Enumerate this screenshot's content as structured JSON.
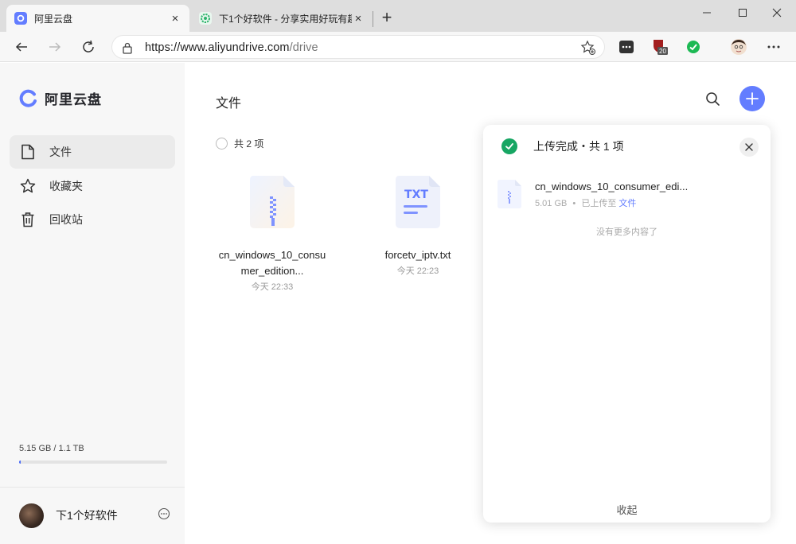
{
  "browser": {
    "tabs": [
      {
        "title": "阿里云盘",
        "close": "×"
      },
      {
        "title": "下1个好软件 - 分享实用好玩有趣",
        "close": "×"
      }
    ],
    "new_tab": "+",
    "url_host": "https://www.aliyundrive.com",
    "url_path": "/drive",
    "extension_badge": "20"
  },
  "sidebar": {
    "logo_text": "阿里云盘",
    "nav": [
      {
        "label": "文件"
      },
      {
        "label": "收藏夹"
      },
      {
        "label": "回收站"
      }
    ],
    "storage": {
      "text": "5.15 GB / 1.1 TB",
      "used_fraction": 0.005
    },
    "user_name": "下1个好软件"
  },
  "main": {
    "title": "文件",
    "select_all_label": "共 2 项",
    "files": [
      {
        "name": "cn_windows_10_consumer_edition...",
        "time": "今天 22:33",
        "icon": "zip-file-icon"
      },
      {
        "name": "forcetv_iptv.txt",
        "time": "今天 22:23",
        "icon": "txt-file-icon",
        "badge": "TXT"
      }
    ]
  },
  "upload_panel": {
    "title": "上传完成・共 1 项",
    "item": {
      "name": "cn_windows_10_consumer_edi...",
      "size": "5.01 GB",
      "dot": "•",
      "status": "已上传至",
      "dest": "文件"
    },
    "no_more": "没有更多内容了",
    "collapse": "收起"
  },
  "colors": {
    "accent": "#637dff",
    "success": "#17a663"
  }
}
